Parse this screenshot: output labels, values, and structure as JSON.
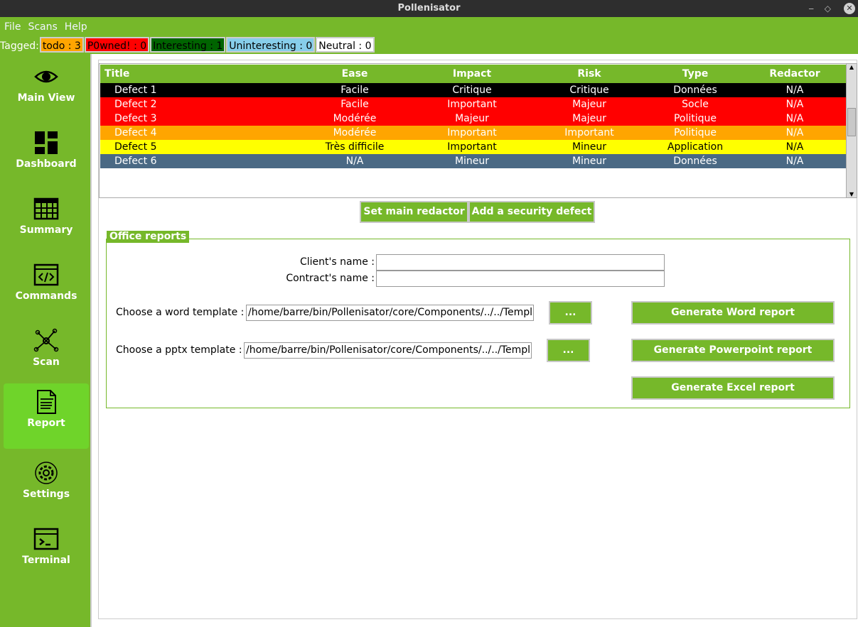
{
  "window": {
    "title": "Pollenisator"
  },
  "menu": [
    "File",
    "Scans",
    "Help"
  ],
  "tags": {
    "label": "Tagged:",
    "items": [
      {
        "text": "todo : 3",
        "color": "#ffa500"
      },
      {
        "text": "P0wned! : 0",
        "color": "#ff0000"
      },
      {
        "text": "Interesting : 1",
        "color": "#006400"
      },
      {
        "text": "Uninteresting : 0",
        "color": "#87ceeb"
      },
      {
        "text": "Neutral : 0",
        "color": "#ffffff"
      }
    ]
  },
  "sidebar": {
    "items": [
      {
        "label": "Main View",
        "icon": "eye-icon"
      },
      {
        "label": "Dashboard",
        "icon": "dashboard-icon"
      },
      {
        "label": "Summary",
        "icon": "table-icon"
      },
      {
        "label": "Commands",
        "icon": "code-icon"
      },
      {
        "label": "Scan",
        "icon": "network-icon"
      },
      {
        "label": "Report",
        "icon": "document-icon",
        "active": true
      },
      {
        "label": "Settings",
        "icon": "gear-icon"
      },
      {
        "label": "Terminal",
        "icon": "terminal-icon"
      }
    ]
  },
  "defects": {
    "columns": [
      "Title",
      "Ease",
      "Impact",
      "Risk",
      "Type",
      "Redactor"
    ],
    "rows": [
      {
        "cells": [
          "Defect 1",
          "Facile",
          "Critique",
          "Critique",
          "Données",
          "N/A"
        ],
        "bg": "#000000",
        "fg": "#ffffff"
      },
      {
        "cells": [
          "Defect 2",
          "Facile",
          "Important",
          "Majeur",
          "Socle",
          "N/A"
        ],
        "bg": "#ff0000",
        "fg": "#ffffff"
      },
      {
        "cells": [
          "Defect 3",
          "Modérée",
          "Majeur",
          "Majeur",
          "Politique",
          "N/A"
        ],
        "bg": "#ff0000",
        "fg": "#ffffff"
      },
      {
        "cells": [
          "Defect 4",
          "Modérée",
          "Important",
          "Important",
          "Politique",
          "N/A"
        ],
        "bg": "#ffa500",
        "fg": "#ffffff"
      },
      {
        "cells": [
          "Defect 5",
          "Très difficile",
          "Important",
          "Mineur",
          "Application",
          "N/A"
        ],
        "bg": "#ffff00",
        "fg": "#000000"
      },
      {
        "cells": [
          "Defect 6",
          "N/A",
          "Mineur",
          "Mineur",
          "Données",
          "N/A"
        ],
        "bg": "#4a6984",
        "fg": "#ffffff"
      }
    ]
  },
  "actions": {
    "set_redactor": "Set main redactor",
    "add_defect": "Add a security defect"
  },
  "office": {
    "title": "Office reports",
    "client_label": "Client's name :",
    "client_value": "",
    "contract_label": "Contract's name :",
    "contract_value": "",
    "word_label": "Choose a word template :",
    "word_path": "/home/barre/bin/Pollenisator/core/Components/../../Templates/",
    "pptx_label": "Choose a pptx template :",
    "pptx_path": "/home/barre/bin/Pollenisator/core/Components/../../Templates/",
    "browse": "...",
    "gen_word": "Generate Word report",
    "gen_ppt": "Generate Powerpoint report",
    "gen_excel": "Generate Excel report"
  }
}
